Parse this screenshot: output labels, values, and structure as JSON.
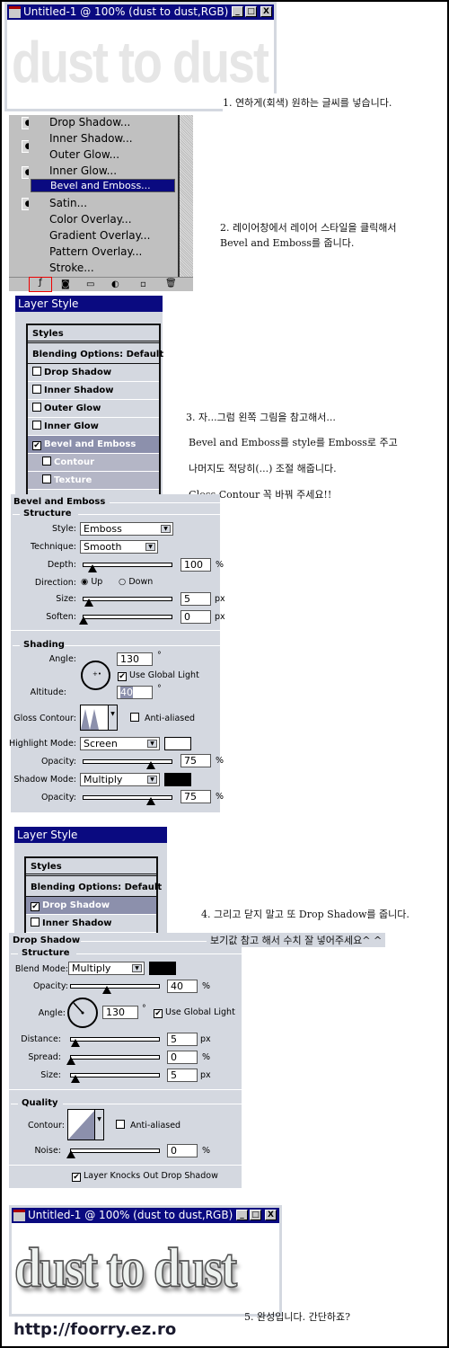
{
  "window1": {
    "title": "Untitled-1 @ 100% (dust to dust,RGB)",
    "text": "dust to dust",
    "minimize": "_",
    "maximize": "□",
    "close": "X"
  },
  "step1": "1. 연하게(회색) 원하는 글씨를 넣습니다.",
  "layers_menu": {
    "items": [
      "Drop Shadow...",
      "Inner Shadow...",
      "Outer Glow...",
      "Inner Glow...",
      "Bevel and Emboss...",
      "Satin...",
      "Color Overlay...",
      "Gradient Overlay...",
      "Pattern Overlay...",
      "Stroke..."
    ],
    "selected": "Bevel and Emboss..."
  },
  "step2": {
    "line1": "2. 레이어창에서 레이어 스타일을 클릭해서",
    "line2": "Bevel and Emboss를 줍니다."
  },
  "layer_style1": {
    "title": "Layer Style",
    "styles": "Styles",
    "blending": "Blending Options: Default",
    "items": [
      {
        "label": "Drop Shadow",
        "checked": false
      },
      {
        "label": "Inner Shadow",
        "checked": false
      },
      {
        "label": "Outer Glow",
        "checked": false
      },
      {
        "label": "Inner Glow",
        "checked": false
      },
      {
        "label": "Bevel and Emboss",
        "checked": true
      },
      {
        "label": "Contour",
        "checked": false
      },
      {
        "label": "Texture",
        "checked": false
      }
    ]
  },
  "step3": {
    "line1": "3. 자...그럼 왼쪽 그림을 참고해서...",
    "line2": "Bevel and Emboss를 style를 Emboss로 주고",
    "line3": "나머지도 적당히(...) 조절 해줍니다.",
    "line4": "Gloss Contour 꼭 바꿔 주세요!!"
  },
  "bevel": {
    "title": "Bevel and Emboss",
    "structure": "Structure",
    "style_label": "Style:",
    "style": "Emboss",
    "technique_label": "Technique:",
    "technique": "Smooth",
    "depth_label": "Depth:",
    "depth": "100",
    "depth_unit": "%",
    "depth_pct": 10,
    "direction_label": "Direction:",
    "dir_up": "Up",
    "dir_down": "Down",
    "direction": "Up",
    "size_label": "Size:",
    "size": "5",
    "size_unit": "px",
    "soften_label": "Soften:",
    "soften": "0",
    "soften_unit": "px",
    "shading": "Shading",
    "angle_label": "Angle:",
    "angle": "130",
    "deg": "°",
    "global_light": "Use Global Light",
    "altitude_label": "Altitude:",
    "altitude": "40",
    "gloss_label": "Gloss Contour:",
    "anti_aliased": "Anti-aliased",
    "highlight_label": "Highlight Mode:",
    "highlight": "Screen",
    "highlight_color": "#ffffff",
    "opacity_label": "Opacity:",
    "hl_opacity": "75",
    "pct": "%",
    "shadow_label": "Shadow Mode:",
    "shadow": "Multiply",
    "shadow_color": "#000000",
    "sh_opacity": "75"
  },
  "layer_style2": {
    "title": "Layer Style",
    "styles": "Styles",
    "blending": "Blending Options: Default",
    "items": [
      {
        "label": "Drop Shadow",
        "checked": true
      },
      {
        "label": "Inner Shadow",
        "checked": false
      }
    ]
  },
  "step4": {
    "line1": "4. 그리고 닫지 말고 또 Drop Shadow를 줍니다.",
    "line2": "보기값 참고 해서 수치 잘 넣어주세요^ ^"
  },
  "drop": {
    "title": "Drop Shadow",
    "structure": "Structure",
    "blend_label": "Blend Mode:",
    "blend": "Multiply",
    "blend_color": "#000000",
    "opacity_label": "Opacity:",
    "opacity": "40",
    "pct": "%",
    "angle_label": "Angle:",
    "angle": "130",
    "deg": "°",
    "global_light": "Use Global Light",
    "distance_label": "Distance:",
    "distance": "5",
    "px": "px",
    "spread_label": "Spread:",
    "spread": "0",
    "size_label": "Size:",
    "size": "5",
    "quality": "Quality",
    "contour_label": "Contour:",
    "anti_aliased": "Anti-aliased",
    "noise_label": "Noise:",
    "noise": "0",
    "knockout": "Layer Knocks Out Drop Shadow"
  },
  "window2": {
    "title": "Untitled-1 @ 100% (dust to dust,RGB)",
    "text": "dust to dust",
    "minimize": "_",
    "maximize": "□",
    "close": "X"
  },
  "step5": "5. 완성입니다. 간단하죠?",
  "url": "http://foorry.ez.ro"
}
